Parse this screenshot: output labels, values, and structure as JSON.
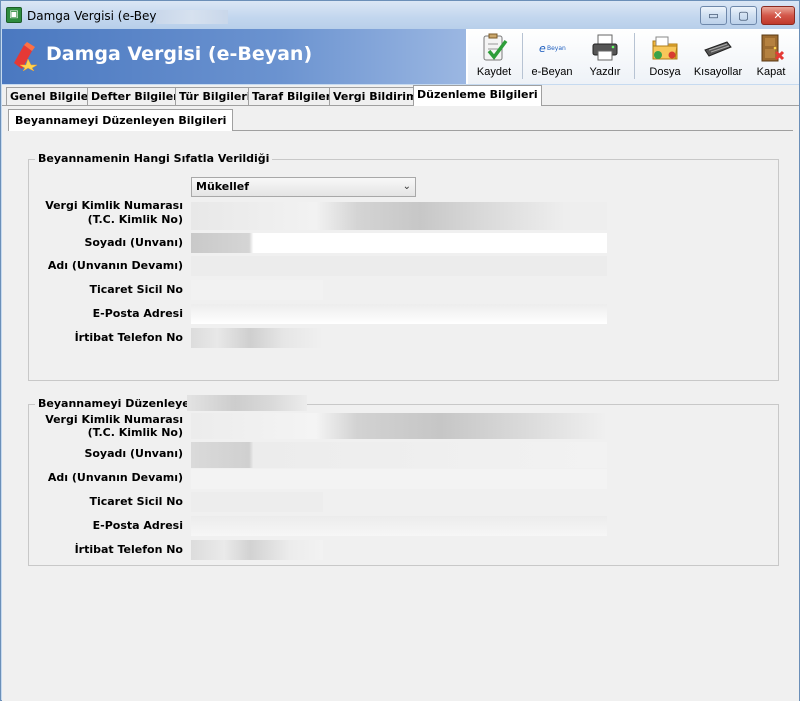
{
  "window": {
    "title": "Damga Vergisi (e-Beyan)",
    "min_glyph": "▭",
    "max_glyph": "▢",
    "close_glyph": "✕"
  },
  "banner": {
    "title": "Damga Vergisi (e-Beyan)"
  },
  "toolbar": {
    "save": "Kaydet",
    "ebeyan": "e-Beyan",
    "ebeyan_icon_text": "Beyan",
    "print": "Yazdır",
    "file": "Dosya",
    "shortcuts": "Kısayollar",
    "close": "Kapat"
  },
  "tabs": [
    {
      "label": "Genel Bilgiler"
    },
    {
      "label": "Defter Bilgileri"
    },
    {
      "label": "Tür Bilgileri"
    },
    {
      "label": "Taraf Bilgileri"
    },
    {
      "label": "Vergi Bildirimi"
    },
    {
      "label": "Düzenleme Bilgileri"
    }
  ],
  "subtab": "Beyannameyi Düzenleyen Bilgileri",
  "group1": {
    "title": "Beyannamenin Hangi Sıfatla Verildiği",
    "capacity_value": "Mükellef",
    "labels": {
      "tckn_1": "Vergi Kimlik Numarası",
      "tckn_2": "(T.C. Kimlik No)",
      "surname": "Soyadı (Unvanı)",
      "name": "Adı (Unvanın Devamı)",
      "trade": "Ticaret Sicil No",
      "email": "E-Posta Adresi",
      "phone": "İrtibat Telefon No"
    }
  },
  "group2": {
    "title": "Beyannameyi Düzenleyen",
    "labels": {
      "tckn_1": "Vergi Kimlik Numarası",
      "tckn_2": "(T.C. Kimlik No)",
      "surname": "Soyadı (Unvanı)",
      "name": "Adı (Unvanın Devamı)",
      "trade": "Ticaret Sicil No",
      "email": "E-Posta Adresi",
      "phone": "İrtibat Telefon No"
    }
  },
  "colors": {
    "banner_blue": "#4a78c0",
    "close_red": "#c0392b",
    "panel_gray": "#f0f0f0"
  }
}
